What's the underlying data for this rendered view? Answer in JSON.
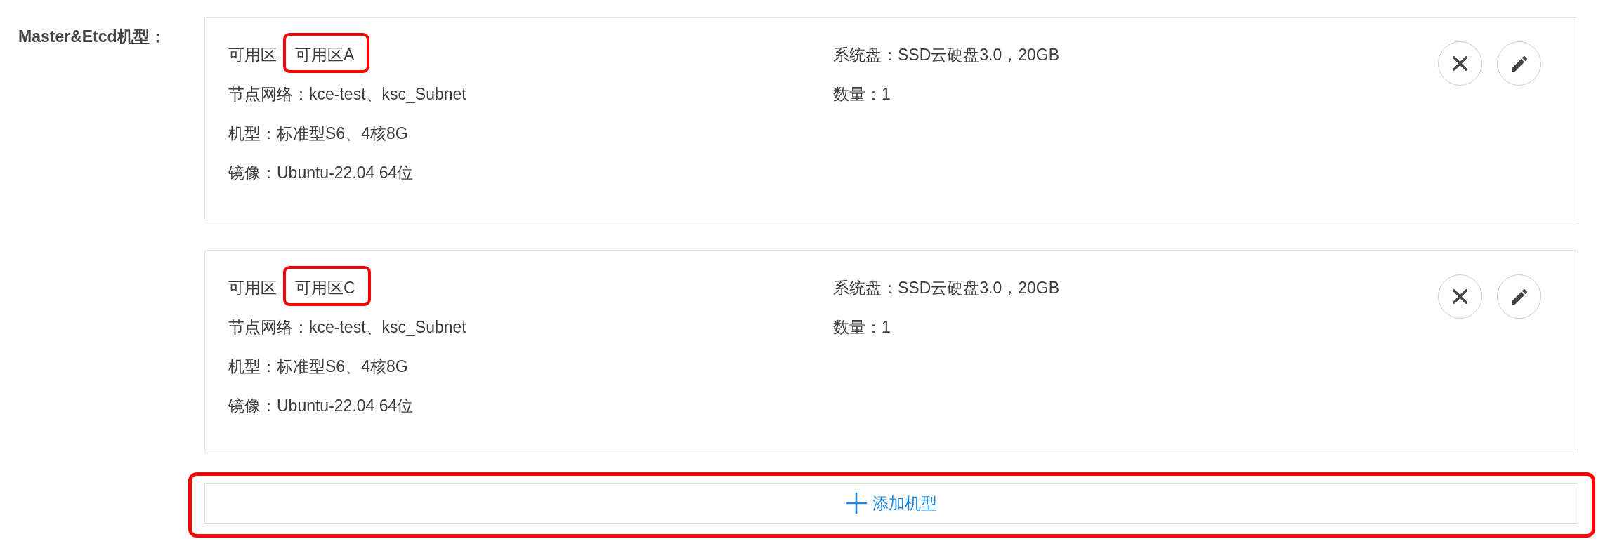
{
  "form_row": {
    "label": "Master&Etcd机型：",
    "cards": [
      {
        "columns": [
          {
            "fields": [
              {
                "label": "可用区",
                "value": "可用区A",
                "highlighted": true
              },
              {
                "label": "节点网络：",
                "value": "kce-test、ksc_Subnet",
                "highlighted": false
              },
              {
                "label": "机型：",
                "value": "标准型S6、4核8G",
                "highlighted": false
              },
              {
                "label": "镜像：",
                "value": "Ubuntu-22.04 64位",
                "highlighted": false
              }
            ]
          },
          {
            "fields": [
              {
                "label": "系统盘：",
                "value": "SSD云硬盘3.0，20GB",
                "highlighted": false
              },
              {
                "label": "数量：",
                "value": "1",
                "highlighted": false
              }
            ]
          }
        ]
      },
      {
        "columns": [
          {
            "fields": [
              {
                "label": "可用区",
                "value": "可用区C",
                "highlighted": true
              },
              {
                "label": "节点网络：",
                "value": "kce-test、ksc_Subnet",
                "highlighted": false
              },
              {
                "label": "机型：",
                "value": "标准型S6、4核8G",
                "highlighted": false
              },
              {
                "label": "镜像：",
                "value": "Ubuntu-22.04 64位",
                "highlighted": false
              }
            ]
          },
          {
            "fields": [
              {
                "label": "系统盘：",
                "value": "SSD云硬盘3.0，20GB",
                "highlighted": false
              },
              {
                "label": "数量：",
                "value": "1",
                "highlighted": false
              }
            ]
          }
        ]
      }
    ],
    "add_button": {
      "label": "添加机型",
      "highlighted": true
    }
  }
}
